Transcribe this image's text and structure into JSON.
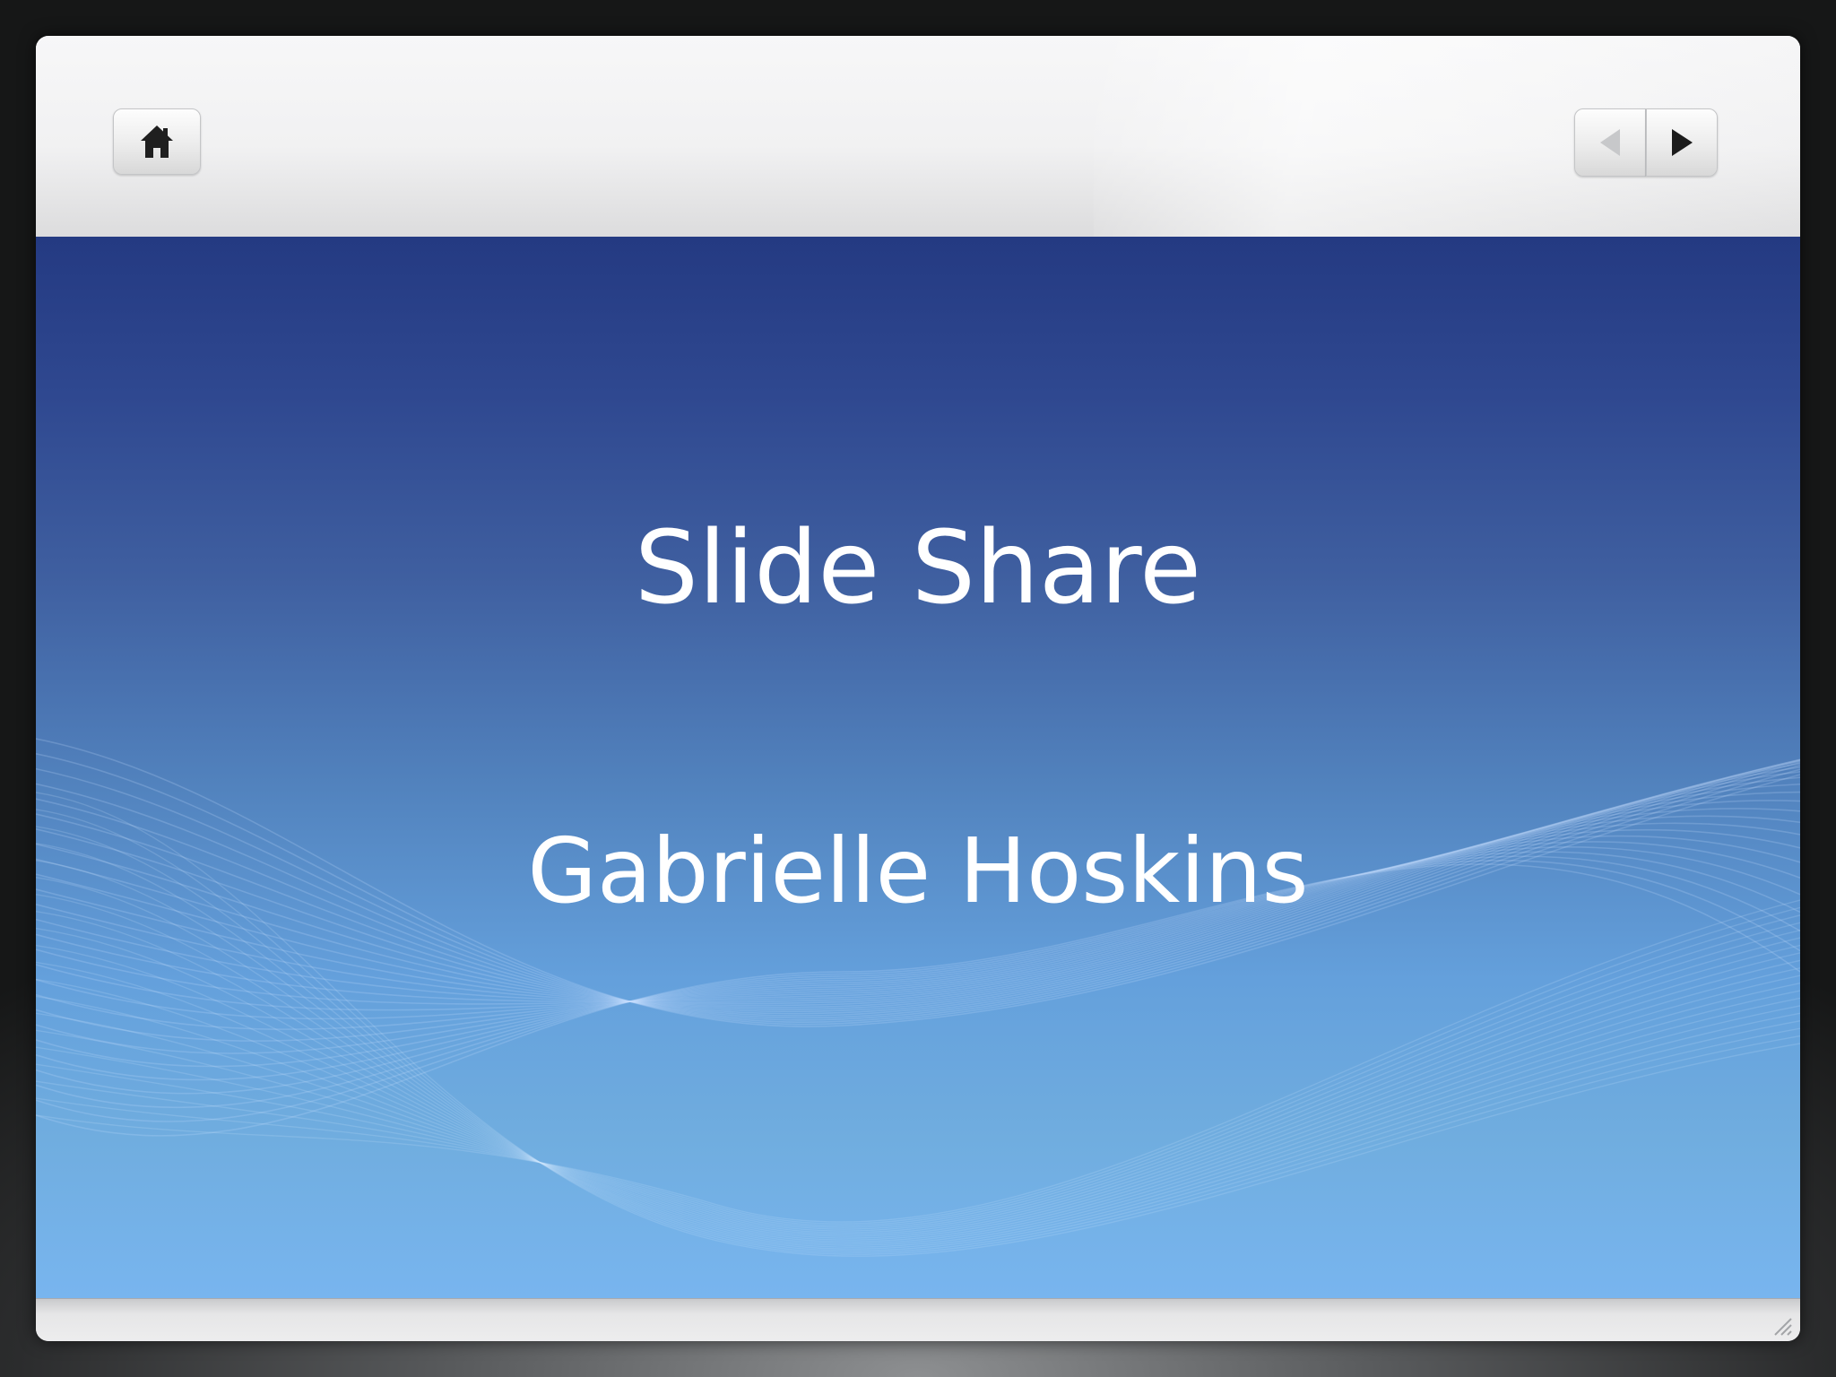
{
  "toolbar": {
    "home_icon": "home-icon",
    "prev_icon": "triangle-left-icon",
    "next_icon": "triangle-right-icon",
    "prev_enabled": false,
    "next_enabled": true
  },
  "slide": {
    "title": "Slide Share",
    "subtitle": "Gabrielle Hoskins"
  },
  "colors": {
    "slide_top": "#243a82",
    "slide_bottom": "#78b5ef",
    "text": "#ffffff",
    "chrome": "#f1f1f2"
  }
}
